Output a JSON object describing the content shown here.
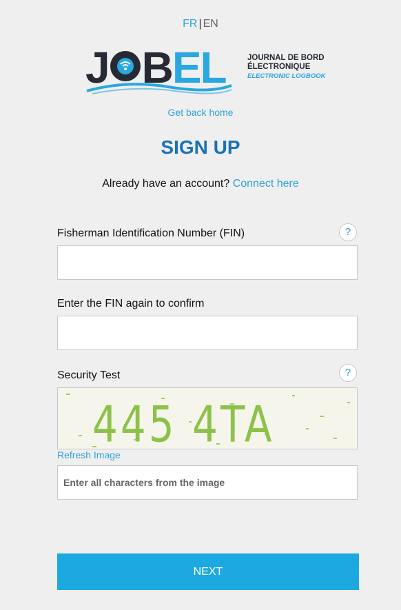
{
  "language": {
    "fr": "FR",
    "separator": "|",
    "en": "EN"
  },
  "logo": {
    "letters_dark_1": "J",
    "letters_dark_2": "B",
    "letters_blue": "EL",
    "line1": "JOURNAL DE BORD",
    "line2": "ÉLECTRONIQUE",
    "line3": "ELECTRONIC LOGBOOK"
  },
  "nav": {
    "home_link": "Get back home"
  },
  "page": {
    "title": "SIGN UP"
  },
  "account": {
    "prompt": "Already have an account?",
    "link": "Connect here"
  },
  "form": {
    "fin_label": "Fisherman Identification Number (FIN)",
    "fin_value": "",
    "fin_confirm_label": "Enter the FIN again to confirm",
    "fin_confirm_value": "",
    "help_symbol": "?",
    "security_label": "Security Test",
    "captcha_text": "445 4TA",
    "refresh_label": "Refresh Image",
    "captcha_placeholder": "Enter all characters from the image",
    "next_label": "NEXT"
  },
  "colors": {
    "background": "#efefef",
    "accent": "#2aa2d9",
    "title": "#1a73b5",
    "button": "#1ca9e1",
    "captcha_text": "#8dc24a"
  },
  "icons": {
    "help": "question-mark-icon",
    "logo_o": "wifi-icon"
  }
}
